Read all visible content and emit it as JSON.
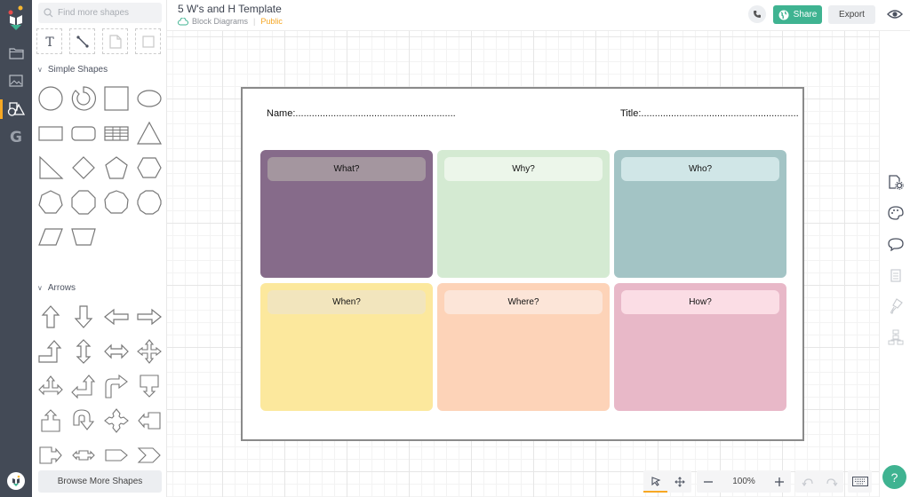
{
  "header": {
    "title": "5 W's and H Template",
    "folder": "Block Diagrams",
    "visibility": "Public",
    "share_label": "Share",
    "export_label": "Export"
  },
  "panel": {
    "search_placeholder": "Find more shapes",
    "quick_tools": [
      "text-tool",
      "connector-tool",
      "note-tool",
      "container-tool"
    ],
    "sections": [
      {
        "title": "Simple Shapes",
        "shapes": [
          "circle",
          "donut",
          "square",
          "ellipse",
          "rectangle",
          "rounded-rectangle",
          "table",
          "triangle",
          "right-triangle",
          "diamond",
          "pentagon",
          "hexagon",
          "heptagon",
          "octagon",
          "nonagon",
          "decagon",
          "parallelogram",
          "trapezoid"
        ]
      },
      {
        "title": "Arrows",
        "shapes": [
          "arrow-up",
          "arrow-down",
          "arrow-left",
          "arrow-right",
          "arrow-bent-up",
          "arrow-up-down",
          "arrow-left-right",
          "arrow-quad",
          "arrow-tri",
          "arrow-bent-left-up",
          "arrow-turn-right",
          "callout-down",
          "callout-up",
          "arrow-u-turn",
          "arrow-quad-diamond",
          "callout-left",
          "callout-right",
          "callout-left-right",
          "pentagon-arrow",
          "chevron"
        ]
      }
    ],
    "browse_label": "Browse More Shapes"
  },
  "document": {
    "name_label": "Name:...........................................................",
    "title_label": "Title:..........................................................",
    "cards": [
      {
        "label": "What?",
        "bg": "#866b8a",
        "cap": "#a4969f"
      },
      {
        "label": "Why?",
        "bg": "#d4ead2",
        "cap": "#ecf6ea"
      },
      {
        "label": "Who?",
        "bg": "#a3c4c5",
        "cap": "#d0e6e7"
      },
      {
        "label": "When?",
        "bg": "#fce89d",
        "cap": "#f2e5bd"
      },
      {
        "label": "Where?",
        "bg": "#fdd3b8",
        "cap": "#fce5d8"
      },
      {
        "label": "How?",
        "bg": "#e8b8c8",
        "cap": "#fbdde5"
      }
    ]
  },
  "toolbar": {
    "zoom_level": "100%"
  },
  "help_label": "?",
  "colors": {
    "accent": "#3fb391",
    "active": "#f7a823",
    "rail": "#434a56"
  }
}
